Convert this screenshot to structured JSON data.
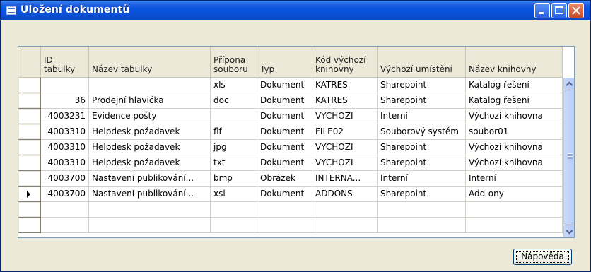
{
  "window": {
    "title": "Uložení dokumentů"
  },
  "grid": {
    "headers": [
      "ID tabulky",
      "Název tabulky",
      "Přípona souboru",
      "Typ",
      "Kód výchozí knihovny",
      "Výchozí umístění",
      "Název knihovny"
    ],
    "rows": [
      [
        "",
        "",
        "xls",
        "Dokument",
        "KATRES",
        "Sharepoint",
        "Katalog řešení"
      ],
      [
        "36",
        "Prodejní hlavička",
        "doc",
        "Dokument",
        "KATRES",
        "Sharepoint",
        "Katalog řešení"
      ],
      [
        "4003231",
        "Evidence pošty",
        "",
        "Dokument",
        "VYCHOZI",
        "Interní",
        "Výchozí knihovna"
      ],
      [
        "4003310",
        "Helpdesk požadavek",
        "flf",
        "Dokument",
        "FILE02",
        "Souborový systém",
        "soubor01"
      ],
      [
        "4003310",
        "Helpdesk požadavek",
        "jpg",
        "Dokument",
        "VYCHOZI",
        "Sharepoint",
        "Výchozí knihovna"
      ],
      [
        "4003310",
        "Helpdesk požadavek",
        "txt",
        "Dokument",
        "VYCHOZI",
        "Sharepoint",
        "Výchozí knihovna"
      ],
      [
        "4003700",
        "Nastavení publikování...",
        "bmp",
        "Obrázek",
        "INTERNA...",
        "Interní",
        "Interní"
      ],
      [
        "4003700",
        "Nastavení publikování...",
        "xsl",
        "Dokument",
        "ADDONS",
        "Sharepoint",
        "Add-ony"
      ],
      [
        "",
        "",
        "",
        "",
        "",
        "",
        ""
      ],
      [
        "",
        "",
        "",
        "",
        "",
        "",
        ""
      ]
    ],
    "current_row": 7
  },
  "buttons": {
    "help": "Nápověda"
  },
  "colors": {
    "titlebar": "#0B4FD6",
    "window_bg": "#ECE9D8"
  }
}
